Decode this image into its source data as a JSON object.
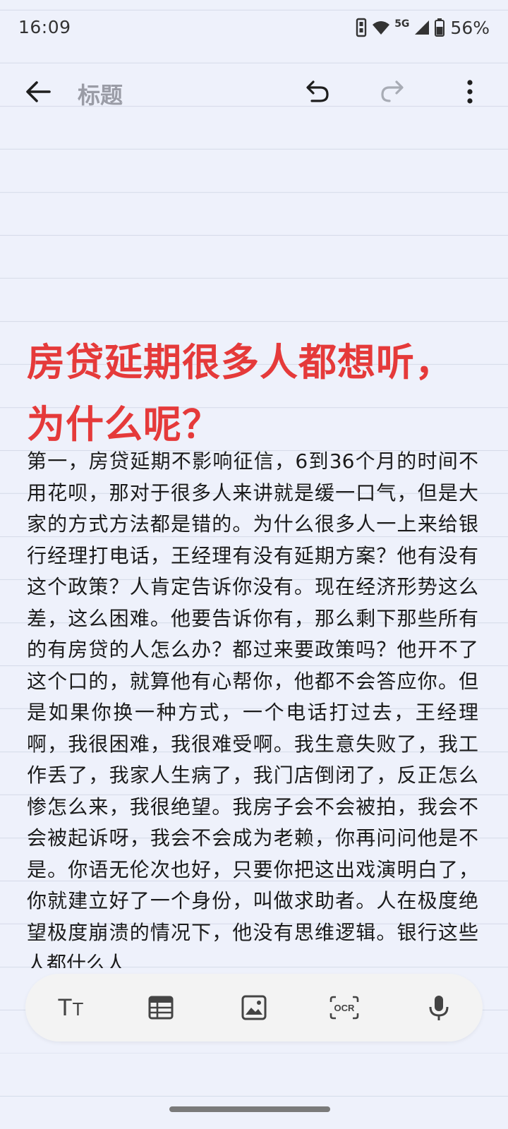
{
  "status_bar": {
    "time": "16:09",
    "network": "5G",
    "battery": "56%",
    "icons": [
      "vibrate-icon",
      "wifi-icon",
      "cellular-signal-icon",
      "battery-icon"
    ]
  },
  "toolbar": {
    "title_placeholder": "标题",
    "icons": [
      "back-arrow-icon",
      "undo-icon",
      "redo-icon",
      "more-vert-icon"
    ]
  },
  "note": {
    "headline": "房贷延期很多人都想听，为什么呢？",
    "body": "第一，房贷延期不影响征信，6到36个月的时间不用花呗，那对于很多人来讲就是缓一口气，但是大家的方式方法都是错的。为什么很多人一上来给银行经理打电话，王经理有没有延期方案？他有没有这个政策？人肯定告诉你没有。现在经济形势这么差，这么困难。他要告诉你有，那么剩下那些所有的有房贷的人怎么办？都过来要政策吗？他开不了这个口的，就算他有心帮你，他都不会答应你。但是如果你换一种方式，一个电话打过去，王经理啊，我很困难，我很难受啊。我生意失败了，我工作丢了，我家人生病了，我门店倒闭了，反正怎么惨怎么来，我很绝望。我房子会不会被拍，我会不会被起诉呀，我会不会成为老赖，你再问问他是不是。你语无伦次也好，只要你把这出戏演明白了，你就建立好了一个身份，叫做求助者。人在极度绝望极度崩溃的情况下，他没有思维逻辑。银行这些人都什么人"
  },
  "bottom_toolbar": {
    "text_format_glyph_big": "T",
    "text_format_glyph_small": "T",
    "ocr_label": "OCR",
    "icons": [
      "text-format-icon",
      "table-icon",
      "image-icon",
      "ocr-icon",
      "microphone-icon"
    ]
  },
  "colors": {
    "background": "#eef1fb",
    "ruled_line": "#d6dbe9",
    "headline": "#e53a3a",
    "body_text": "#1b1b1b",
    "placeholder": "#9a9ca6",
    "bottom_bar": "#f3f3f3"
  }
}
